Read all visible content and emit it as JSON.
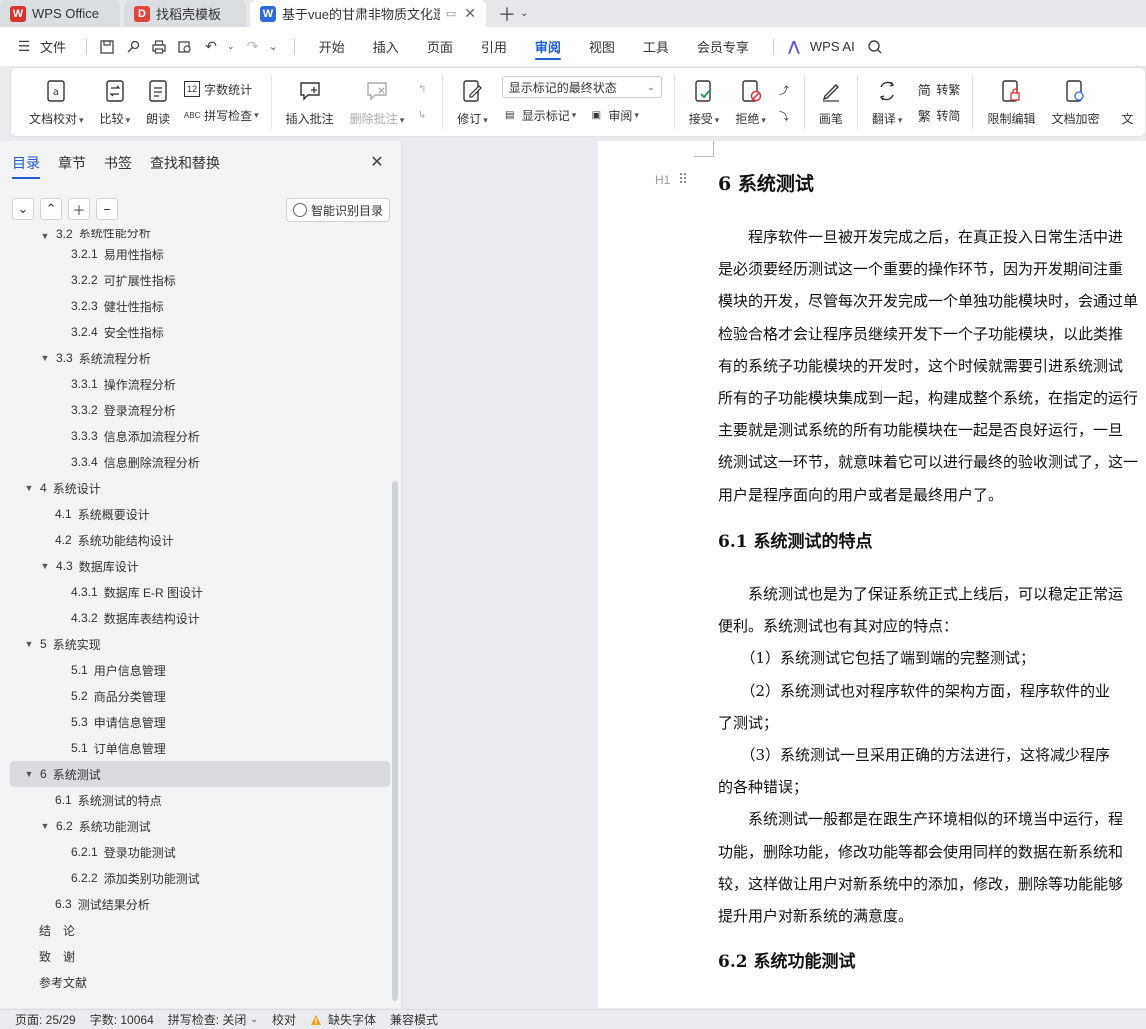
{
  "tabs": [
    {
      "label": "WPS Office",
      "logo": "W",
      "logo_color": "#d9342b"
    },
    {
      "label": "找稻壳模板",
      "logo": "D",
      "logo_color": "#e0473c"
    },
    {
      "label": "基于vue的甘肃非物质文化遗产",
      "logo": "W",
      "logo_color": "#2f6bdc"
    }
  ],
  "menubar": {
    "file_label": "文件",
    "tabs": [
      "开始",
      "插入",
      "页面",
      "引用",
      "审阅",
      "视图",
      "工具",
      "会员专享"
    ],
    "active_tab": "审阅",
    "wps_ai_label": "WPS AI"
  },
  "ribbon": {
    "doc_check": "文档校对",
    "compare": "比较",
    "read_aloud": "朗读",
    "word_count": "字数统计",
    "spell_check": "拼写检查",
    "insert_comment": "插入批注",
    "delete_comment": "删除批注",
    "track_changes": "修订",
    "display_mode": "显示标记的最终状态",
    "show_markup": "显示标记",
    "review": "审阅",
    "accept": "接受",
    "reject": "拒绝",
    "ink": "画笔",
    "translate": "翻译",
    "to_traditional": "转繁",
    "to_simplified": "转简",
    "restrict_edit": "限制编辑",
    "encrypt": "文档加密",
    "cut_off": "文"
  },
  "nav": {
    "tabs": [
      "目录",
      "章节",
      "书签",
      "查找和替换"
    ],
    "smart_toc": "智能识别目录",
    "outline": [
      {
        "num": "3.2",
        "label": "系统性能分析",
        "level": 2,
        "arrow": true
      },
      {
        "num": "3.2.1",
        "label": "易用性指标",
        "level": 3
      },
      {
        "num": "3.2.2",
        "label": "可扩展性指标",
        "level": 3
      },
      {
        "num": "3.2.3",
        "label": "健壮性指标",
        "level": 3
      },
      {
        "num": "3.2.4",
        "label": "安全性指标",
        "level": 3
      },
      {
        "num": "3.3",
        "label": "系统流程分析",
        "level": 2,
        "arrow": true
      },
      {
        "num": "3.3.1",
        "label": "操作流程分析",
        "level": 3
      },
      {
        "num": "3.3.2",
        "label": "登录流程分析",
        "level": 3
      },
      {
        "num": "3.3.3",
        "label": "信息添加流程分析",
        "level": 3
      },
      {
        "num": "3.3.4",
        "label": "信息删除流程分析",
        "level": 3
      },
      {
        "num": "4",
        "label": "系统设计",
        "level": 1,
        "arrow": true
      },
      {
        "num": "4.1",
        "label": "系统概要设计",
        "level": 2
      },
      {
        "num": "4.2",
        "label": "系统功能结构设计",
        "level": 2
      },
      {
        "num": "4.3",
        "label": "数据库设计",
        "level": 2,
        "arrow": true
      },
      {
        "num": "4.3.1",
        "label": "数据库 E-R 图设计",
        "level": 3
      },
      {
        "num": "4.3.2",
        "label": "数据库表结构设计",
        "level": 3
      },
      {
        "num": "5",
        "label": "系统实现",
        "level": 1,
        "arrow": true
      },
      {
        "num": "5.1",
        "label": "用户信息管理",
        "level": 3
      },
      {
        "num": "5.2",
        "label": "商品分类管理",
        "level": 3
      },
      {
        "num": "5.3",
        "label": "申请信息管理",
        "level": 3
      },
      {
        "num": "5.1",
        "label": "订单信息管理",
        "level": 3
      },
      {
        "num": "6",
        "label": "系统测试",
        "level": 1,
        "arrow": true,
        "selected": true
      },
      {
        "num": "6.1",
        "label": "系统测试的特点",
        "level": 2
      },
      {
        "num": "6.2",
        "label": "系统功能测试",
        "level": 2,
        "arrow": true
      },
      {
        "num": "6.2.1",
        "label": "登录功能测试",
        "level": 3
      },
      {
        "num": "6.2.2",
        "label": "添加类别功能测试",
        "level": 3
      },
      {
        "num": "6.3",
        "label": "测试结果分析",
        "level": 2
      },
      {
        "num": "",
        "label": "结　论",
        "level": 1
      },
      {
        "num": "",
        "label": "致　谢",
        "level": 1
      },
      {
        "num": "",
        "label": "参考文献",
        "level": 1
      }
    ]
  },
  "doc": {
    "h_tag": "H1",
    "heading1": "6  系统测试",
    "lines_a": [
      "　　程序软件一旦被开发完成之后，在真正投入日常生活中进",
      "是必须要经历测试这一个重要的操作环节，因为开发期间注重",
      "模块的开发，尽管每次开发完成一个单独功能模块时，会通过单",
      "检验合格才会让程序员继续开发下一个子功能模块，以此类推",
      "有的系统子功能模块的开发时，这个时候就需要引进系统测试",
      "所有的子功能模块集成到一起，构建成整个系统，在指定的运行",
      "主要就是测试系统的所有功能模块在一起是否良好运行，一旦",
      "统测试这一环节，就意味着它可以进行最终的验收测试了，这一",
      "用户是程序面向的用户或者是最终用户了。"
    ],
    "heading2a": "6.1  系统测试的特点",
    "lines_b": [
      "　　系统测试也是为了保证系统正式上线后，可以稳定正常运",
      "便利。系统测试也有其对应的特点：",
      "　　（1）系统测试它包括了端到端的完整测试；",
      "　　（2）系统测试也对程序软件的架构方面，程序软件的业",
      "了测试；",
      "　　（3）系统测试一旦采用正确的方法进行，这将减少程序",
      "的各种错误；",
      "　　系统测试一般都是在跟生产环境相似的环境当中运行，程",
      "功能，删除功能，修改功能等都会使用同样的数据在新系统和",
      "较，这样做让用户对新系统中的添加，修改，删除等功能能够",
      "提升用户对新系统的满意度。"
    ],
    "heading2b": "6.2  系统功能测试"
  },
  "status": {
    "page": "页面: 25/29",
    "words": "字数: 10064",
    "spell": "拼写检查: 关闭",
    "proof": "校对",
    "missing_font": "缺失字体",
    "compat": "兼容模式"
  },
  "colors": {
    "accent": "#1f5dcf",
    "warning": "#f0a020"
  }
}
